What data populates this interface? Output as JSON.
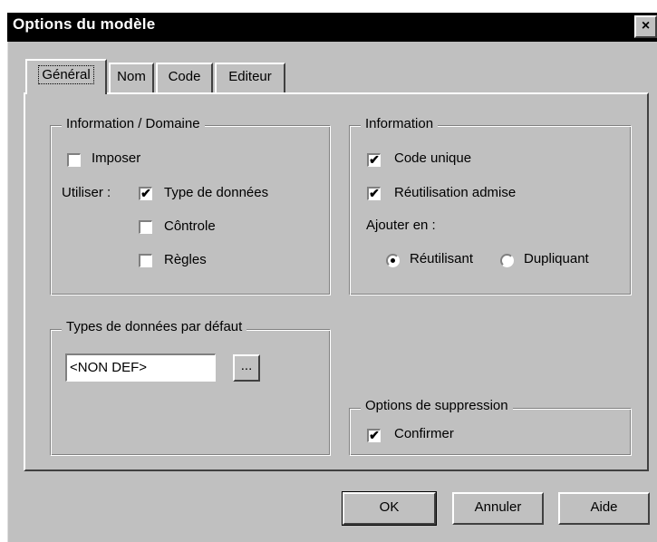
{
  "window": {
    "title": "Options du modèle",
    "close_glyph": "×"
  },
  "tabs": [
    {
      "label": "Général",
      "active": true
    },
    {
      "label": "Nom",
      "active": false
    },
    {
      "label": "Code",
      "active": false
    },
    {
      "label": "Editeur",
      "active": false
    }
  ],
  "info_domaine": {
    "legend": "Information / Domaine",
    "imposer": {
      "label": "Imposer",
      "checked": false
    },
    "utiliser_label": "Utiliser :",
    "type_donnees": {
      "label": "Type de données",
      "checked": true
    },
    "controle": {
      "label": "Côntrole",
      "checked": false
    },
    "regles": {
      "label": "Règles",
      "checked": false
    }
  },
  "information": {
    "legend": "Information",
    "code_unique": {
      "label": "Code unique",
      "checked": true
    },
    "reutilisation": {
      "label": "Réutilisation admise",
      "checked": true
    },
    "ajouter_label": "Ajouter en :",
    "reutilisant": {
      "label": "Réutilisant",
      "selected": true
    },
    "dupliquant": {
      "label": "Dupliquant",
      "selected": false
    }
  },
  "types_defaut": {
    "legend": "Types de données par défaut",
    "value": "<NON DEF>",
    "browse_label": "..."
  },
  "suppression": {
    "legend": "Options de suppression",
    "confirmer": {
      "label": "Confirmer",
      "checked": true
    }
  },
  "buttons": {
    "ok": "OK",
    "annuler": "Annuler",
    "aide": "Aide"
  },
  "glyphs": {
    "check": "✔"
  }
}
